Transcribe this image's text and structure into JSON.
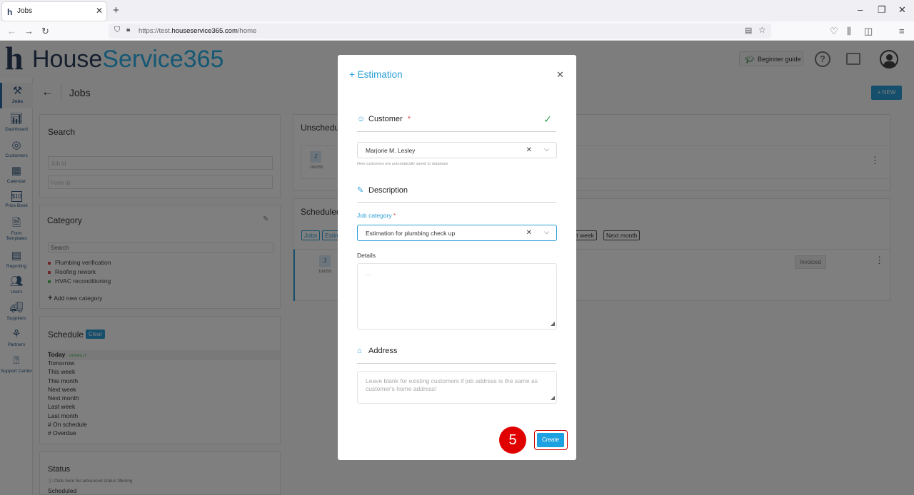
{
  "browser": {
    "tab_title": "Jobs",
    "url_prefix": "https://test.",
    "url_domain": "houseservice365.com",
    "url_path": "/home"
  },
  "app": {
    "logo_house": "House",
    "logo_service": "Service365",
    "beginner_guide": "Beginner guide",
    "page_title": "Jobs",
    "new_button": "+ NEW"
  },
  "sidebar": {
    "items": [
      {
        "label": "Jobs",
        "icon": "tools-icon"
      },
      {
        "label": "Dashboard",
        "icon": "bar-chart-icon"
      },
      {
        "label": "Customers",
        "icon": "target-icon"
      },
      {
        "label": "Calendar",
        "icon": "calendar-icon"
      },
      {
        "label": "Price Book",
        "icon": "price-book-icon"
      },
      {
        "label": "Form Templates",
        "icon": "form-icon"
      },
      {
        "label": "Reporting",
        "icon": "report-icon"
      },
      {
        "label": "Users",
        "icon": "users-icon"
      },
      {
        "label": "Suppliers",
        "icon": "truck-icon"
      },
      {
        "label": "Partners",
        "icon": "network-icon"
      },
      {
        "label": "Support Center",
        "icon": "help-icon"
      }
    ]
  },
  "search": {
    "title": "Search",
    "job_id_placeholder": "Job id",
    "form_id_placeholder": "Form id"
  },
  "category": {
    "title": "Category",
    "search_placeholder": "Search",
    "items": [
      {
        "label": "Plumbing verification",
        "color": "#d9534f"
      },
      {
        "label": "Roofing rework",
        "color": "#d9534f"
      },
      {
        "label": "HVAC reconditioning",
        "color": "#5cb85c"
      }
    ],
    "add_new": "Add new category"
  },
  "schedule": {
    "title": "Schedule",
    "clear": "Clear",
    "today": "Today",
    "default_tag": "- DEFAULT",
    "items": [
      "Tomorrow",
      "This week",
      "This month",
      "Next week",
      "Next month",
      "Last week",
      "Last month",
      "# On schedule",
      "# Overdue"
    ]
  },
  "status": {
    "title": "Status",
    "hint": "Click here for advanced status filtering",
    "first": "Scheduled"
  },
  "unscheduled": {
    "title": "Unschedul",
    "job_letter": "J",
    "job_id": "100255"
  },
  "scheduled": {
    "title": "Scheduled",
    "chips": [
      "Jobs",
      "Estim"
    ],
    "right_chips": [
      "xt week",
      "Next month"
    ],
    "job_letter": "J",
    "job_id": "100255",
    "badge": "Invoiced"
  },
  "modal": {
    "title": "+ Estimation",
    "customer_label": "Customer",
    "required": "*",
    "customer_value": "Marjorie M. Lesley",
    "customer_hint": "New customers are automatically saved to database",
    "description_label": "Description",
    "job_category_label": "Job category",
    "job_category_value": "Estimation for plumbing check up",
    "details_label": "Details",
    "details_placeholder": "...",
    "address_label": "Address",
    "address_placeholder": "Leave blank for existing customers if job address is the same as customer's home address!",
    "create": "Create",
    "step_number": "5"
  },
  "colors": {
    "accent": "#2a9fd6",
    "step_marker": "#e00000",
    "check": "#3aa655"
  }
}
